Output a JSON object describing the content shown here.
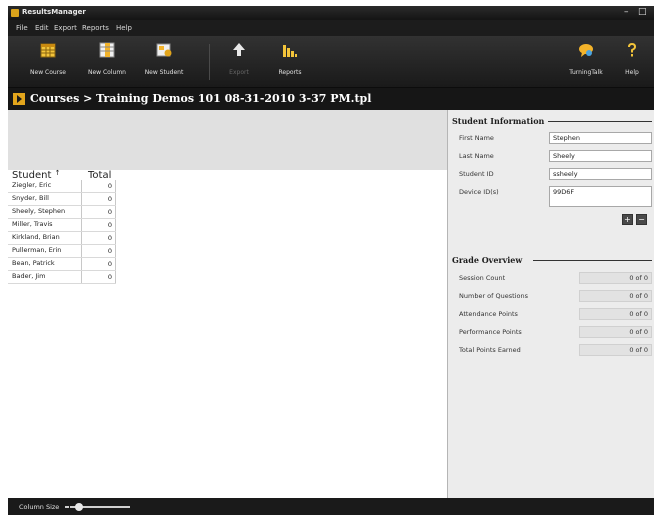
{
  "window": {
    "title": "ResultsManager",
    "minimize_glyph": "–",
    "close_glyph": "□"
  },
  "menu": [
    "File",
    "Edit",
    "Export",
    "Reports",
    "Help"
  ],
  "toolbar": {
    "new_course": "New Course",
    "new_column": "New Column",
    "new_student": "New Student",
    "export": "Export",
    "reports": "Reports",
    "turning_talk": "TurningTalk",
    "help": "Help"
  },
  "path": "Courses > Training Demos 101 08-31-2010 3-37 PM.tpl",
  "gradebook": {
    "student_header": "Student",
    "sort_glyph": "↑",
    "total_header": "Total",
    "rows": [
      {
        "name": "Ziegler, Eric",
        "total": "0"
      },
      {
        "name": "Snyder, Bill",
        "total": "0"
      },
      {
        "name": "Sheely, Stephen",
        "total": "0"
      },
      {
        "name": "Miller, Travis",
        "total": "0"
      },
      {
        "name": "Kirkland, Brian",
        "total": "0"
      },
      {
        "name": "Pullerman, Erin",
        "total": "0"
      },
      {
        "name": "Bean, Patrick",
        "total": "0"
      },
      {
        "name": "Bader, Jim",
        "total": "0"
      }
    ]
  },
  "student_info": {
    "title": "Student Information",
    "first_name_label": "First Name",
    "first_name": "Stephen",
    "last_name_label": "Last Name",
    "last_name": "Sheely",
    "student_id_label": "Student ID",
    "student_id": "ssheely",
    "device_label": "Device ID(s)",
    "device_id": "99D6F",
    "add_glyph": "+",
    "remove_glyph": "−"
  },
  "grade_overview": {
    "title": "Grade Overview",
    "session_count_label": "Session Count",
    "session_count": "0 of 0",
    "questions_label": "Number of Questions",
    "questions": "0 of 0",
    "attendance_label": "Attendance Points",
    "attendance": "0 of 0",
    "performance_label": "Performance Points",
    "performance": "0 of 0",
    "total_label": "Total Points Earned",
    "total": "0 of 0"
  },
  "status": {
    "column_size_label": "Column Size",
    "column_size_level": 0.15
  },
  "colors": {
    "accent": "#e2a51c",
    "toolbar_bg": "#252525",
    "panel_bg": "#ececec"
  },
  "icons": {
    "new_course": "calendar-grid-icon",
    "new_column": "column-table-icon",
    "new_student": "student-card-icon",
    "export": "export-arrow-icon",
    "reports": "bar-chart-icon",
    "turning_talk": "speech-bubble-icon",
    "help": "question-mark-icon"
  }
}
